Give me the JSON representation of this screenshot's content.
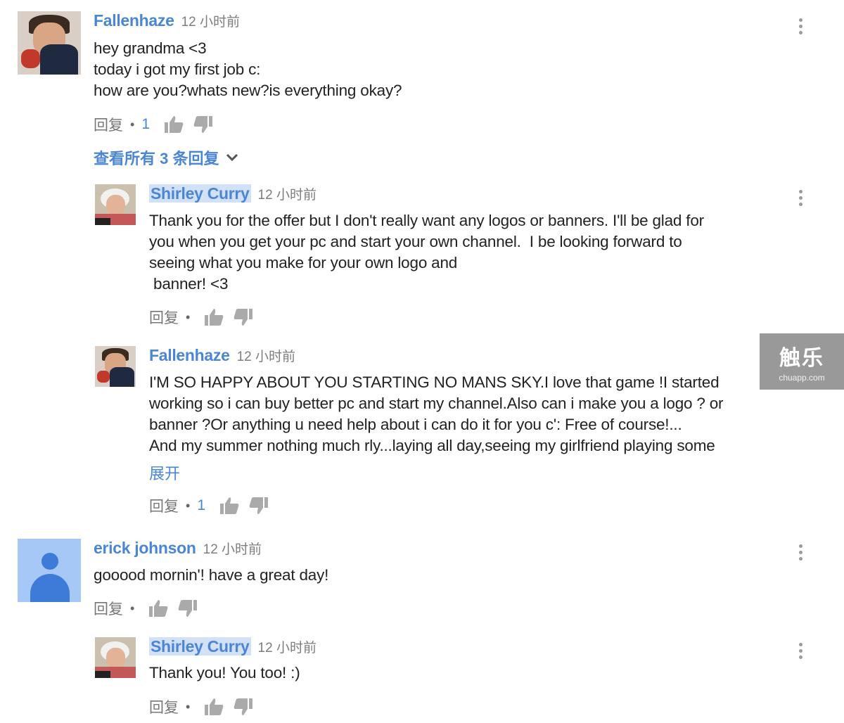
{
  "comments": [
    {
      "author": "Fallenhaze",
      "time": "12 小时前",
      "text": "hey grandma <3\ntoday i got my first job c:\nhow are you?whats new?is everything okay?",
      "reply_label": "回复",
      "likes": "1",
      "view_replies": "查看所有 3 条回复"
    },
    {
      "author": "Shirley Curry",
      "time": "12 小时前",
      "text": "Thank you for the offer but I don't really want any logos or banners. I'll be glad for\nyou when you get your pc and start your own channel.  I be looking forward to\nseeing what you make for your own logo and\n banner! <3",
      "reply_label": "回复"
    },
    {
      "author": "Fallenhaze",
      "time": "12 小时前",
      "text": "I'M SO HAPPY ABOUT YOU STARTING NO MANS SKY.I love that game !I started\nworking so i can buy better pc and start my channel.Also can i make you a logo ? or\nbanner ?Or anything u need help about i can do it for you c': Free of course!...\nAnd my summer nothing much rly...laying all day,seeing my girlfriend playing some",
      "expand": "展开",
      "reply_label": "回复",
      "likes": "1"
    },
    {
      "author": "erick johnson",
      "time": "12 小时前",
      "text": "gooood mornin'! have a great day!",
      "reply_label": "回复"
    },
    {
      "author": "Shirley Curry",
      "time": "12 小时前",
      "text": "Thank you! You too! :)",
      "reply_label": "回复"
    }
  ],
  "watermark": {
    "logo": "触乐",
    "site": "chuapp.com"
  },
  "colors": {
    "link": "#4a86d4",
    "highlight": "#d2e1f5",
    "muted": "#888888"
  },
  "icons": [
    "more-vert-icon",
    "thumb-up-icon",
    "thumb-down-icon",
    "chevron-down-icon",
    "default-avatar-icon"
  ]
}
